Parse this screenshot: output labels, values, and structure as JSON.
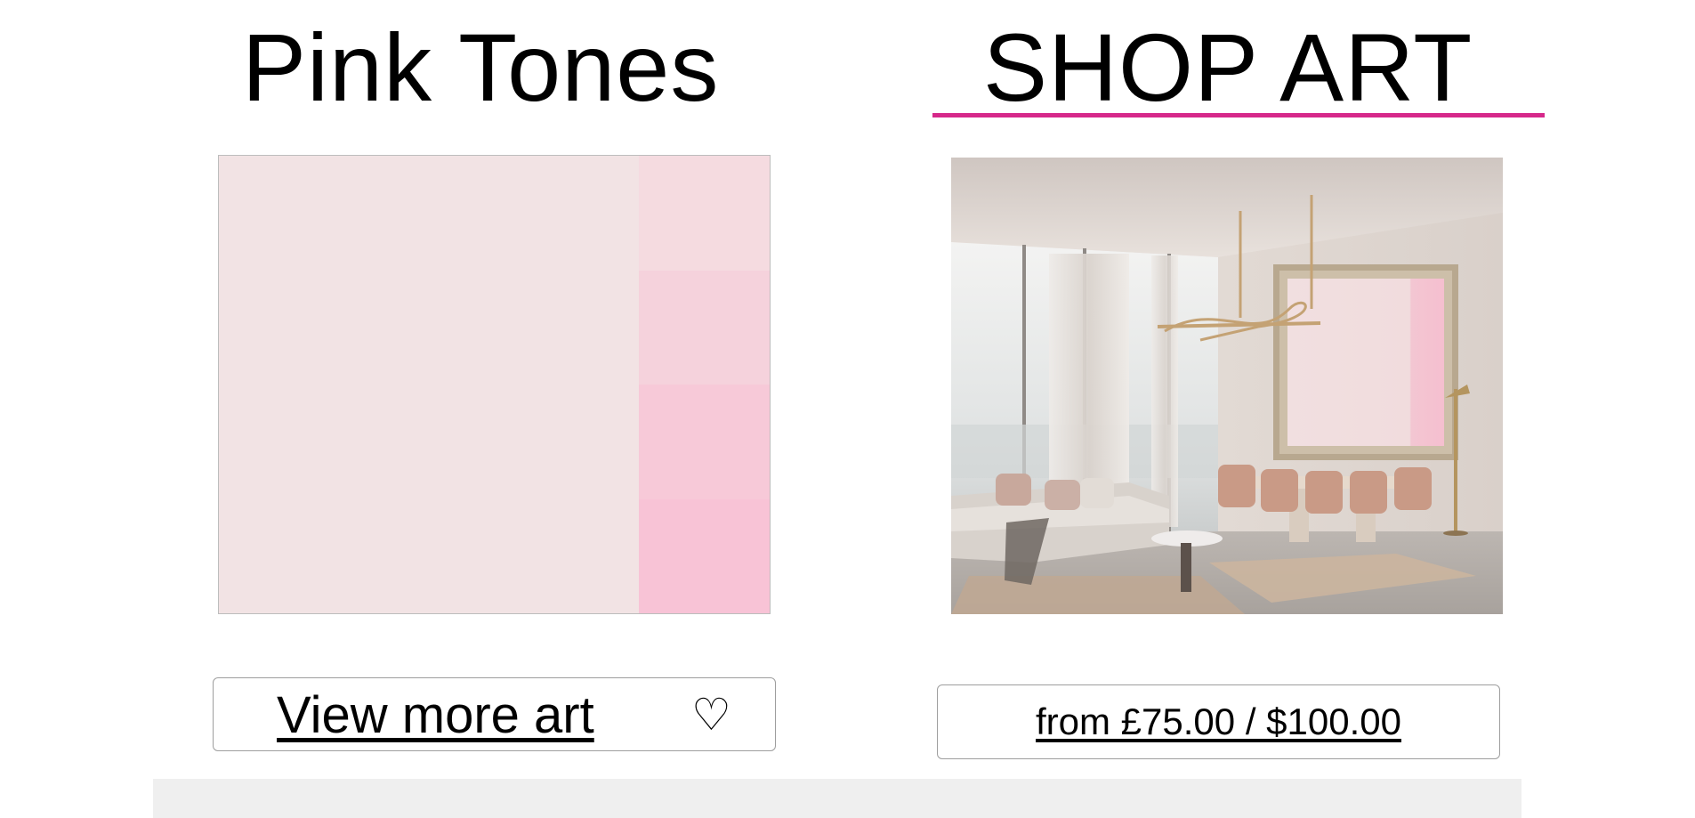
{
  "left_panel": {
    "title": "Pink Tones",
    "swatch": {
      "main_color": "#f2e3e4",
      "strip_colors": [
        "#f5dbe0",
        "#f5d2dc",
        "#f7c9d8",
        "#f8c3d6"
      ]
    },
    "view_more_label": "View more art",
    "heart_glyph": "♡",
    "favorite_icon": "heart-outline-icon"
  },
  "right_panel": {
    "title": "SHOP ART",
    "underline_color": "#d6288a",
    "preview_image": "living-room-with-framed-pink-art",
    "price_label": "from £75.00 / $100.00"
  },
  "colors": {
    "accent": "#d6288a",
    "border": "#9e9e9e",
    "footer_band": "#efefef"
  }
}
